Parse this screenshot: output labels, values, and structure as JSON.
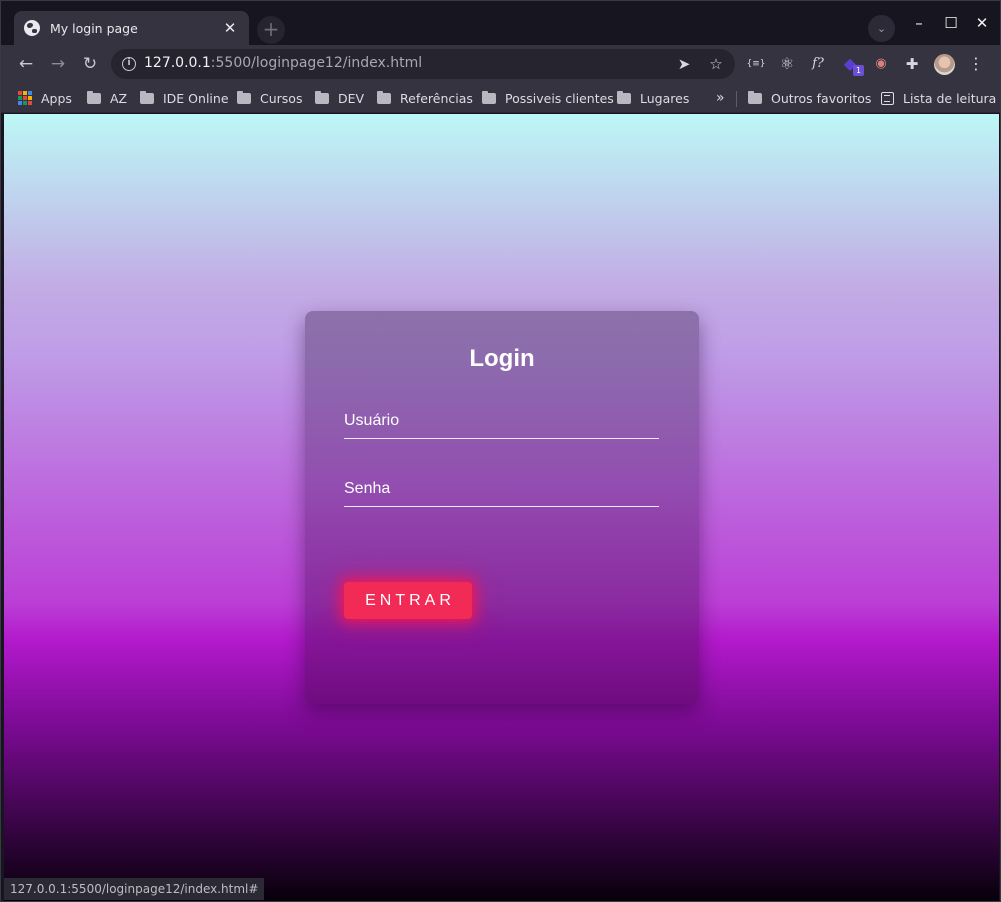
{
  "browser": {
    "tab": {
      "title": "My login page"
    },
    "url": {
      "host": "127.0.0.1",
      "rest": ":5500/loginpage12/index.html"
    },
    "bookmarks": {
      "apps": "Apps",
      "items": [
        "AZ",
        "IDE Online",
        "Cursos",
        "DEV",
        "Referências",
        "Possiveis clientes",
        "Lugares"
      ],
      "overflow": "»",
      "other": "Outros favoritos",
      "reading_list": "Lista de leitura"
    },
    "extensions": {
      "badge_count": "1"
    },
    "status_url": "127.0.0.1:5500/loginpage12/index.html#"
  },
  "login": {
    "title": "Login",
    "username_placeholder": "Usuário",
    "password_placeholder": "Senha",
    "submit_label": "ENTRAR"
  },
  "colors": {
    "button": "#f12a56",
    "gradient_top": "#bdf7f6",
    "gradient_mid": "#b219cb",
    "gradient_bottom": "#07000a"
  }
}
